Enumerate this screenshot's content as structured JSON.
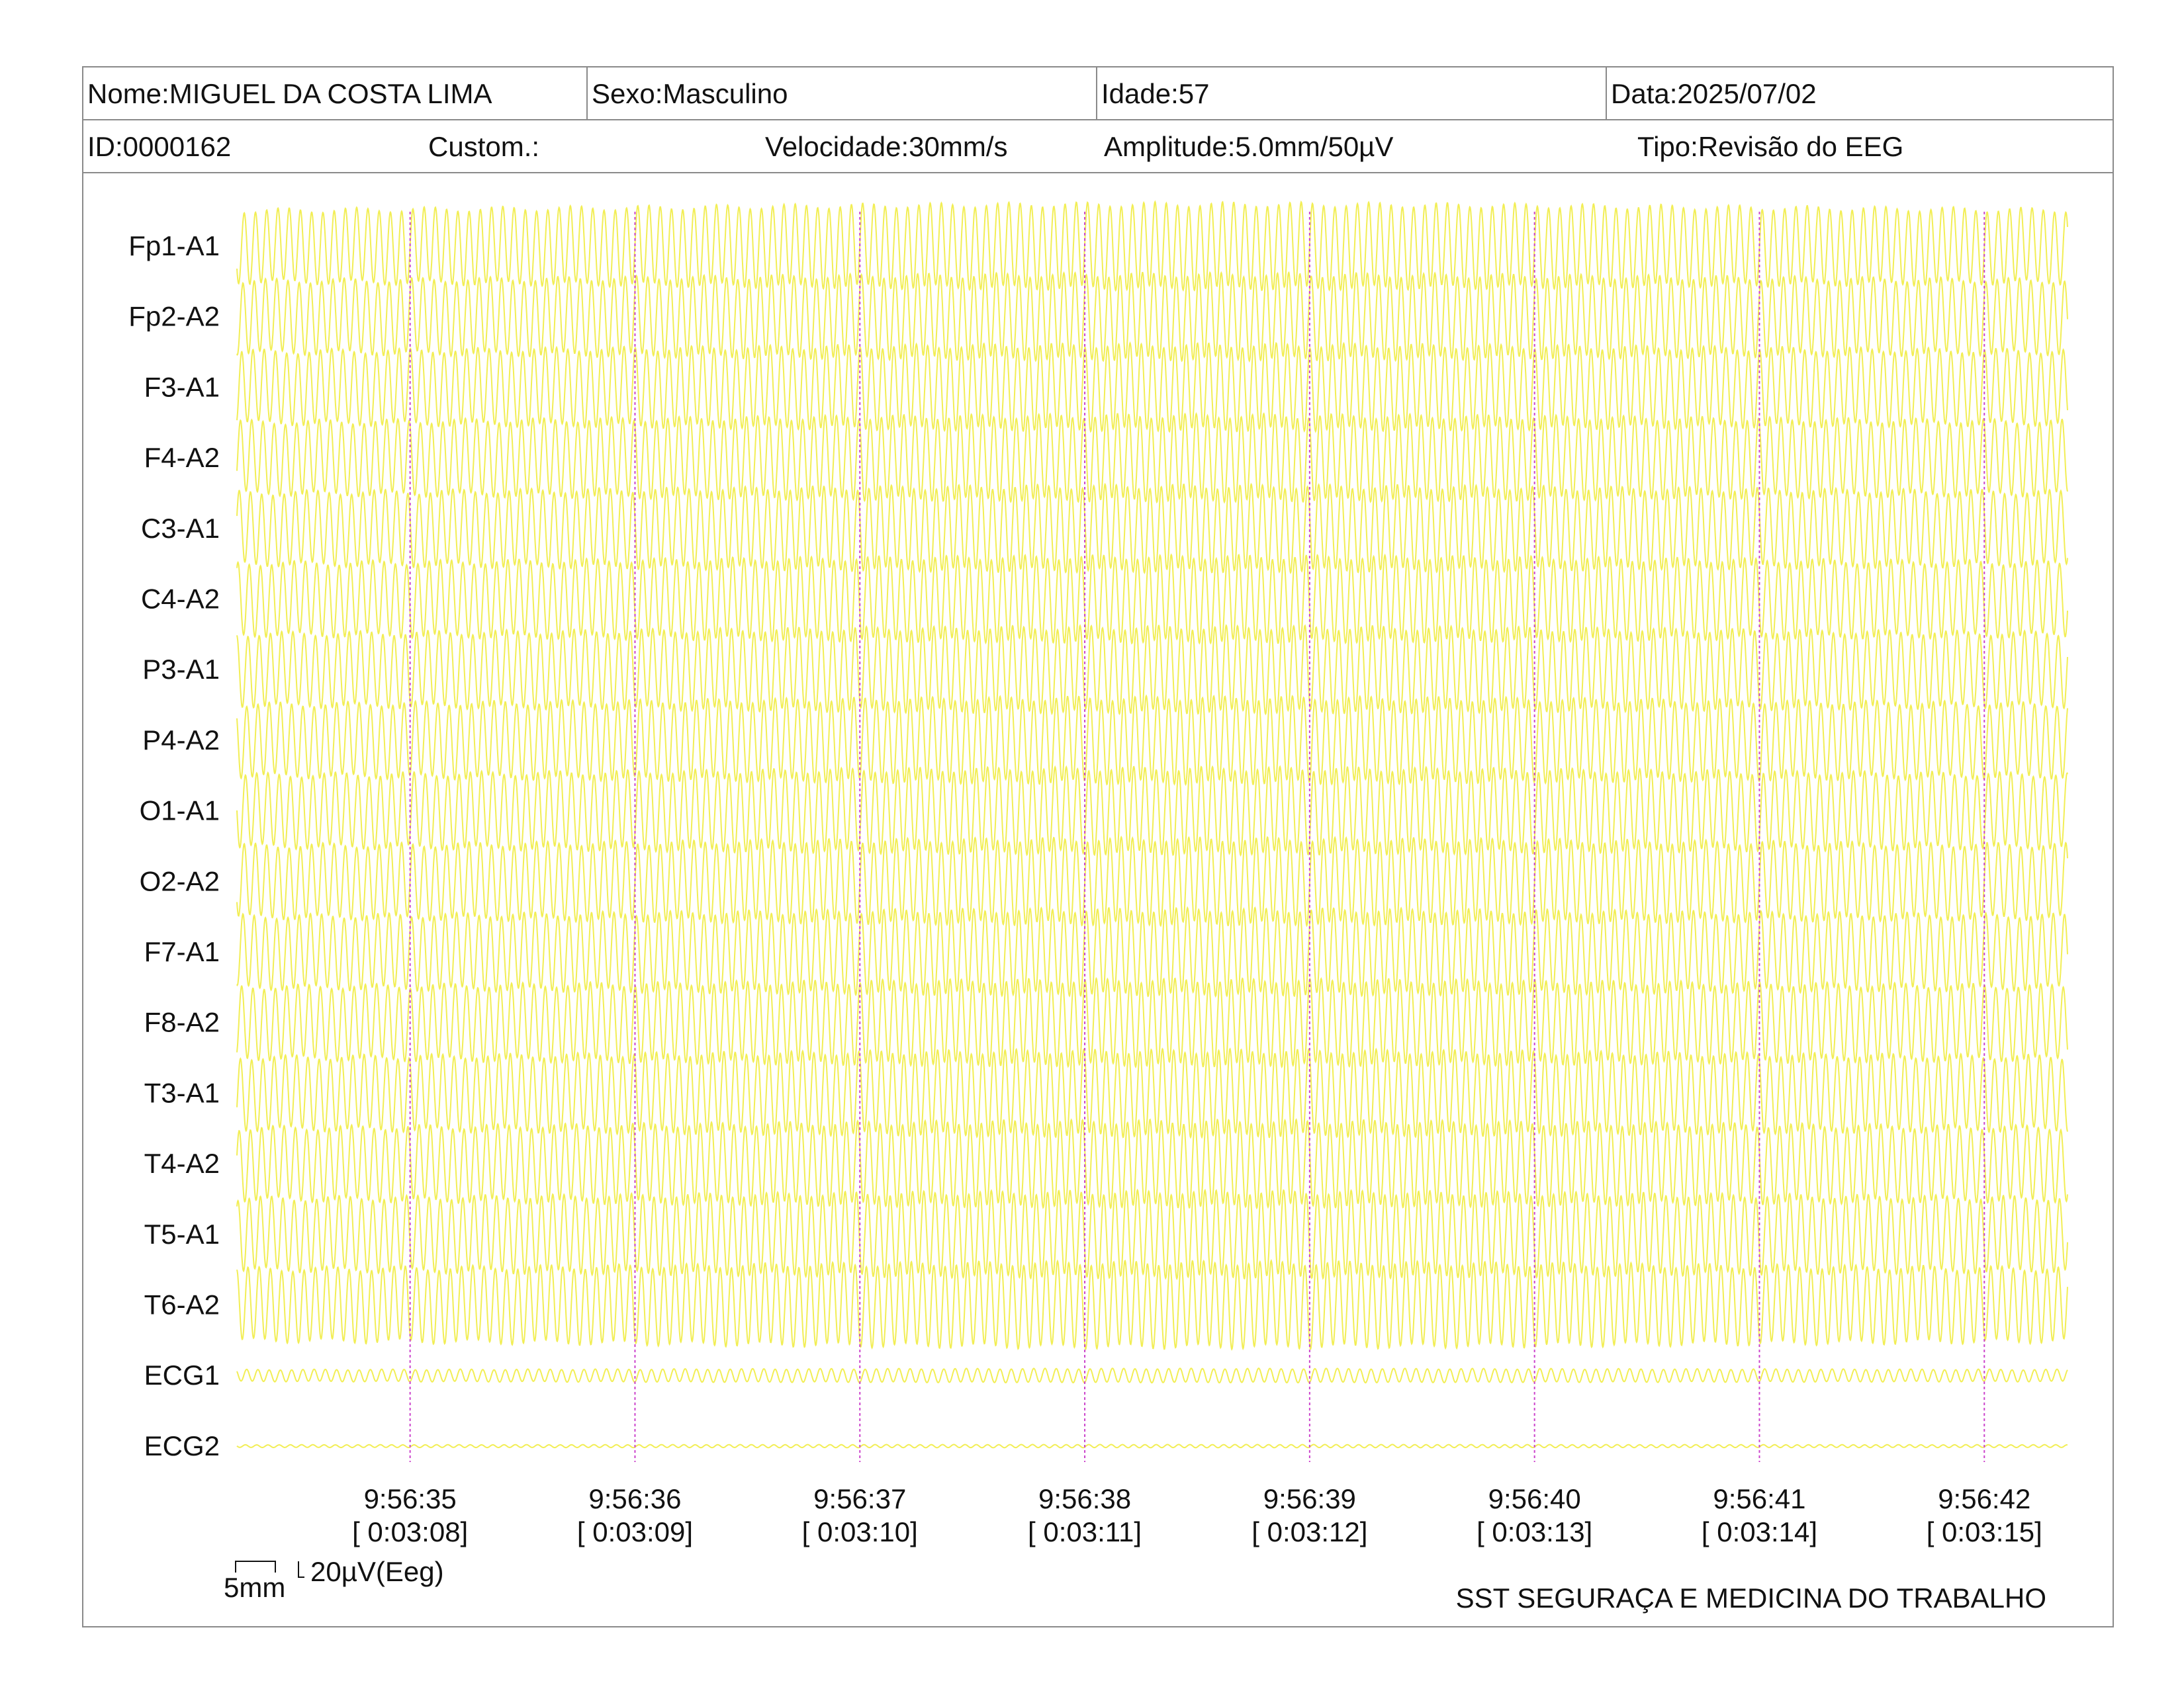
{
  "header": {
    "name": "Nome:MIGUEL DA COSTA LIMA",
    "sex": "Sexo:Masculino",
    "age": "Idade:57",
    "date": "Data:2025/07/02",
    "id": "ID:0000162",
    "custom": "Custom.:",
    "speed": "Velocidade:30mm/s",
    "amplitude": "Amplitude:5.0mm/50µV",
    "type": "Tipo:Revisão do EEG"
  },
  "scale": {
    "time_label": "5mm",
    "amp_label": "20µV(Eeg)"
  },
  "footer": {
    "company": "SST SEGURAÇA E MEDICINA DO TRABALHO"
  },
  "colors": {
    "trace": "#f2ee55",
    "marker": "#cc44cc",
    "text": "#111111",
    "border": "#8a8a8a"
  },
  "chart_data": {
    "type": "line",
    "title": "",
    "xlabel": "",
    "ylabel": "",
    "grid": false,
    "channels": [
      "Fp1-A1",
      "Fp2-A2",
      "F3-A1",
      "F4-A2",
      "C3-A1",
      "C4-A2",
      "P3-A1",
      "P4-A2",
      "O1-A1",
      "O2-A2",
      "F7-A1",
      "F8-A2",
      "T3-A1",
      "T4-A2",
      "T5-A1",
      "T6-A2",
      "ECG1",
      "ECG2"
    ],
    "time_marks": [
      {
        "clock": "9:56:35",
        "elapsed": "[ 0:03:08]"
      },
      {
        "clock": "9:56:36",
        "elapsed": "[ 0:03:09]"
      },
      {
        "clock": "9:56:37",
        "elapsed": "[ 0:03:10]"
      },
      {
        "clock": "9:56:38",
        "elapsed": "[ 0:03:11]"
      },
      {
        "clock": "9:56:39",
        "elapsed": "[ 0:03:12]"
      },
      {
        "clock": "9:56:40",
        "elapsed": "[ 0:03:13]"
      },
      {
        "clock": "9:56:41",
        "elapsed": "[ 0:03:14]"
      },
      {
        "clock": "9:56:42",
        "elapsed": "[ 0:03:15]"
      }
    ],
    "x_seconds": [
      -0.77,
      7.37
    ],
    "time_mark_seconds": [
      0,
      1,
      2,
      3,
      4,
      5,
      6,
      7
    ],
    "wave_hz": 20,
    "channel_amplitude_uv": [
      55,
      55,
      55,
      55,
      55,
      55,
      55,
      55,
      55,
      55,
      55,
      55,
      55,
      55,
      55,
      55,
      9,
      2
    ],
    "amplitude_envelope_peak_seconds": 3.5
  }
}
